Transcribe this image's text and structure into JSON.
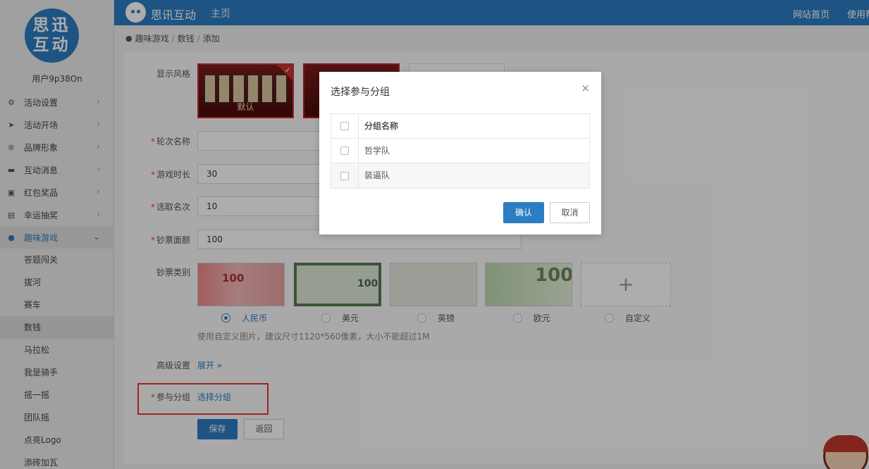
{
  "app": {
    "brand": "思讯互动",
    "home": "主页",
    "top_links": [
      "网站首页",
      "使用帮助"
    ],
    "logo_text_line1": "思迅",
    "logo_text_line2": "互动",
    "username": "用户9p38On"
  },
  "sidebar": {
    "items": [
      {
        "label": "活动设置",
        "icon": "gears-icon"
      },
      {
        "label": "活动开场",
        "icon": "paper-plane-icon"
      },
      {
        "label": "品牌形象",
        "icon": "registered-icon"
      },
      {
        "label": "互动消息",
        "icon": "message-icon"
      },
      {
        "label": "红包奖品",
        "icon": "gift-icon"
      },
      {
        "label": "幸运抽奖",
        "icon": "lottery-icon"
      },
      {
        "label": "趣味游戏",
        "icon": "gamepad-icon"
      }
    ],
    "sub_items": [
      "答题闯关",
      "拔河",
      "赛车",
      "数钱",
      "马拉松",
      "我是骑手",
      "摇一摇",
      "团队摇",
      "点亮Logo",
      "添砖加瓦"
    ]
  },
  "breadcrumb": [
    "趣味游戏",
    "数钱",
    "添加"
  ],
  "form": {
    "style_label": "显示风格",
    "style_default_name": "默认",
    "round_label": "轮次名称",
    "round_value": "",
    "duration_label": "游戏时长",
    "duration_value": "30",
    "pick_label": "选取名次",
    "pick_value": "10",
    "face_label": "钞票面额",
    "face_value": "100",
    "bill_label": "钞票类别",
    "bill_options": [
      "人民币",
      "美元",
      "英镑",
      "欧元",
      "自定义"
    ],
    "bill_selected": "人民币",
    "hint": "使用自定义图片，建议尺寸1120*560像素，大小不能超过1M",
    "advanced_label": "高级设置",
    "advanced_link": "展开 »",
    "group_label": "参与分组",
    "group_link": "选择分组",
    "save": "保存",
    "back": "返回"
  },
  "modal": {
    "title": "选择参与分组",
    "close": "×",
    "column": "分组名称",
    "rows": [
      "哲学队",
      "装逼队"
    ],
    "confirm": "确认",
    "cancel": "取消"
  },
  "colors": {
    "primary": "#2d7dc2",
    "highlight": "#e53935",
    "required": "#e43"
  }
}
